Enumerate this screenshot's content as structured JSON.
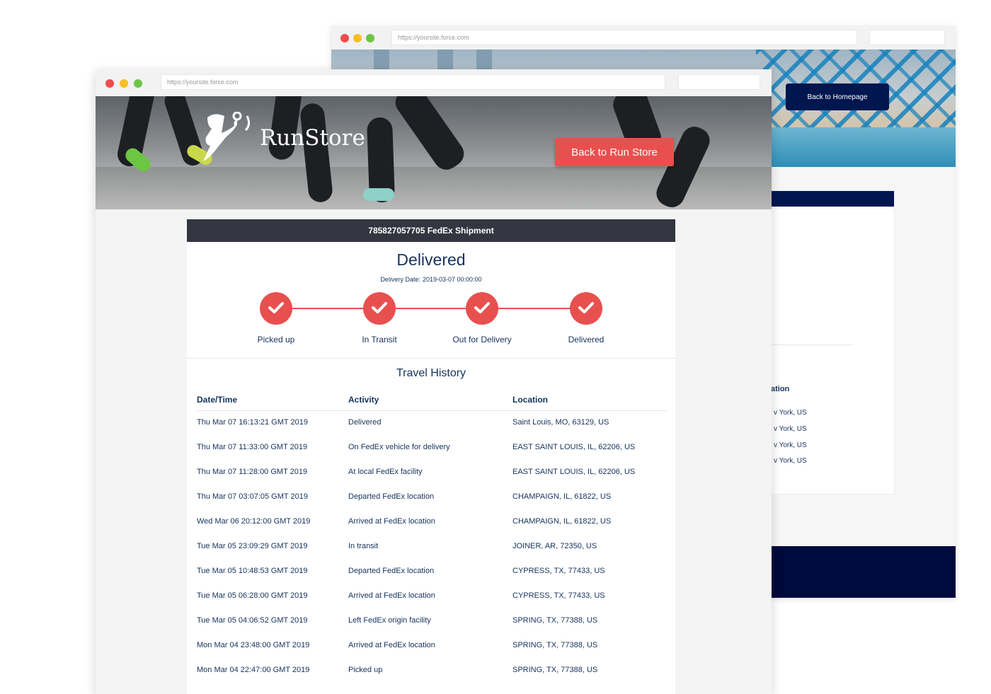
{
  "back_window": {
    "url": "https://yoursite.force.com",
    "back_button": "Back to Homepage",
    "location_header": "ation",
    "location_rows": [
      "v York, US",
      "v York, US",
      "v York, US",
      "v York, US"
    ]
  },
  "front_window": {
    "url": "https://yoursite.force.com",
    "logo_text": "RunStore",
    "back_button": "Back to Run Store",
    "shipment_header": "785827057705 FedEx Shipment",
    "status": "Delivered",
    "delivery_date_label": "Delivery Date:",
    "delivery_date_value": "2019-03-07 00:00:00",
    "steps": [
      {
        "label": "Picked up"
      },
      {
        "label": "In Transit"
      },
      {
        "label": "Out for Delivery"
      },
      {
        "label": "Delivered"
      }
    ],
    "travel_history_title": "Travel History",
    "columns": {
      "datetime": "Date/Time",
      "activity": "Activity",
      "location": "Location"
    },
    "history": [
      {
        "datetime": "Thu Mar 07 16:13:21 GMT 2019",
        "activity": "Delivered",
        "location": "Saint Louis, MO, 63129, US"
      },
      {
        "datetime": "Thu Mar 07 11:33:00 GMT 2019",
        "activity": "On FedEx vehicle for delivery",
        "location": "EAST SAINT LOUIS, IL, 62206, US"
      },
      {
        "datetime": "Thu Mar 07 11:28:00 GMT 2019",
        "activity": "At local FedEx facility",
        "location": "EAST SAINT LOUIS, IL, 62206, US"
      },
      {
        "datetime": "Thu Mar 07 03:07:05 GMT 2019",
        "activity": "Departed FedEx location",
        "location": "CHAMPAIGN, IL, 61822, US"
      },
      {
        "datetime": "Wed Mar 06 20:12:00 GMT 2019",
        "activity": "Arrived at FedEx location",
        "location": "CHAMPAIGN, IL, 61822, US"
      },
      {
        "datetime": "Tue Mar 05 23:09:29 GMT 2019",
        "activity": "In transit",
        "location": "JOINER, AR, 72350, US"
      },
      {
        "datetime": "Tue Mar 05 10:48:53 GMT 2019",
        "activity": "Departed FedEx location",
        "location": "CYPRESS, TX, 77433, US"
      },
      {
        "datetime": "Tue Mar 05 06:28:00 GMT 2019",
        "activity": "Arrived at FedEx location",
        "location": "CYPRESS, TX, 77433, US"
      },
      {
        "datetime": "Tue Mar 05 04:06:52 GMT 2019",
        "activity": "Left FedEx origin facility",
        "location": "SPRING, TX, 77388, US"
      },
      {
        "datetime": "Mon Mar 04 23:48:00 GMT 2019",
        "activity": "Arrived at FedEx location",
        "location": "SPRING, TX, 77388, US"
      },
      {
        "datetime": "Mon Mar 04 22:47:00 GMT 2019",
        "activity": "Picked up",
        "location": "SPRING, TX, 77388, US"
      }
    ]
  },
  "colors": {
    "accent_red": "#e8504f",
    "navy": "#00164e",
    "header_dark": "#333640",
    "text_blue": "#16325c"
  },
  "icons": {
    "step_icon": "check-icon",
    "logo_icon": "runner-icon"
  }
}
